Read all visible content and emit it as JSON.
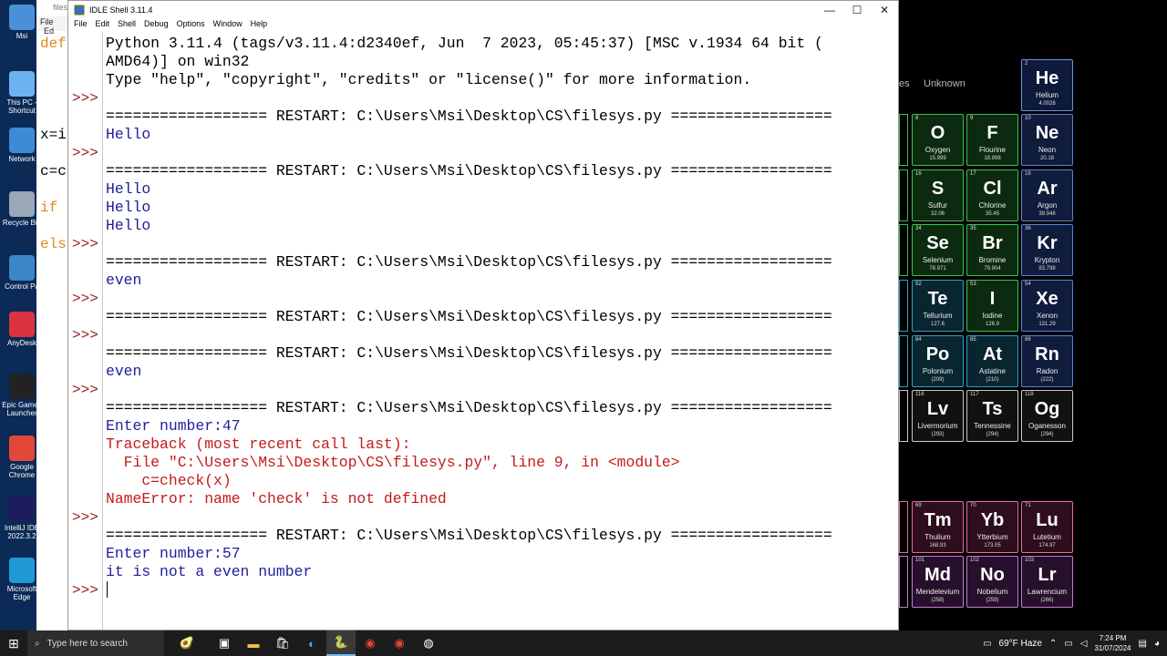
{
  "desktop": {
    "icons": [
      {
        "label": "Msi"
      },
      {
        "label": "This PC - Shortcut"
      },
      {
        "label": "Network"
      },
      {
        "label": "Recycle Bin"
      },
      {
        "label": "Control Pa"
      },
      {
        "label": "AnyDesk"
      },
      {
        "label": "Epic Games Launcher"
      },
      {
        "label": "Google Chrome"
      },
      {
        "label": "IntelliJ IDE 2022.3.2"
      },
      {
        "label": "Microsoft Edge"
      }
    ]
  },
  "back_editor": {
    "title": "files",
    "menu": [
      "File",
      "Ed"
    ],
    "code": [
      "def",
      "",
      "",
      "x=i",
      "c=c",
      "if",
      "els"
    ]
  },
  "idle": {
    "title": "IDLE Shell 3.11.4",
    "menu": [
      "File",
      "Edit",
      "Shell",
      "Debug",
      "Options",
      "Window",
      "Help"
    ],
    "controls": {
      "minimize": "—",
      "maximize": "☐",
      "close": "✕"
    },
    "prompt": ">>>",
    "lines": [
      {
        "t": "Python 3.11.4 (tags/v3.11.4:d2340ef, Jun  7 2023, 05:45:37) [MSC v.1934 64 bit (",
        "c": "out"
      },
      {
        "t": "AMD64)] on win32",
        "c": "out"
      },
      {
        "t": "Type \"help\", \"copyright\", \"credits\" or \"license()\" for more information.",
        "c": "out"
      },
      {
        "t": "",
        "c": "out"
      },
      {
        "t": "================== RESTART: C:\\Users\\Msi\\Desktop\\CS\\filesys.py ==================",
        "c": "out"
      },
      {
        "t": "Hello",
        "c": "std"
      },
      {
        "t": "",
        "c": "out"
      },
      {
        "t": "================== RESTART: C:\\Users\\Msi\\Desktop\\CS\\filesys.py ==================",
        "c": "out"
      },
      {
        "t": "Hello",
        "c": "std"
      },
      {
        "t": "Hello",
        "c": "std"
      },
      {
        "t": "Hello",
        "c": "std"
      },
      {
        "t": "",
        "c": "out"
      },
      {
        "t": "================== RESTART: C:\\Users\\Msi\\Desktop\\CS\\filesys.py ==================",
        "c": "out"
      },
      {
        "t": "even",
        "c": "std"
      },
      {
        "t": "",
        "c": "out"
      },
      {
        "t": "================== RESTART: C:\\Users\\Msi\\Desktop\\CS\\filesys.py ==================",
        "c": "out"
      },
      {
        "t": "",
        "c": "out"
      },
      {
        "t": "================== RESTART: C:\\Users\\Msi\\Desktop\\CS\\filesys.py ==================",
        "c": "out"
      },
      {
        "t": "even",
        "c": "std"
      },
      {
        "t": "",
        "c": "out"
      },
      {
        "t": "================== RESTART: C:\\Users\\Msi\\Desktop\\CS\\filesys.py ==================",
        "c": "out"
      },
      {
        "t": "Enter number:47",
        "c": "std"
      },
      {
        "t": "Traceback (most recent call last):",
        "c": "err"
      },
      {
        "t": "  File \"C:\\Users\\Msi\\Desktop\\CS\\filesys.py\", line 9, in <module>",
        "c": "err"
      },
      {
        "t": "    c=check(x)",
        "c": "err"
      },
      {
        "t": "NameError: name 'check' is not defined",
        "c": "err"
      },
      {
        "t": "",
        "c": "out"
      },
      {
        "t": "================== RESTART: C:\\Users\\Msi\\Desktop\\CS\\filesys.py ==================",
        "c": "out"
      },
      {
        "t": "Enter number:57",
        "c": "std"
      },
      {
        "t": "it is not a even number",
        "c": "std"
      }
    ],
    "prompt_rows": [
      3,
      6,
      11,
      14,
      16,
      19,
      26,
      30
    ]
  },
  "periodic": {
    "labels": {
      "left": "es",
      "unknown": "Unknown"
    },
    "elements": [
      {
        "num": "2",
        "sym": "He",
        "name": "Helium",
        "w": "4.0026",
        "g": "he",
        "col": 2,
        "row": 0
      },
      {
        "num": "8",
        "sym": "O",
        "name": "Oxygen",
        "w": "15.999",
        "g": "hal",
        "col": 0,
        "row": 1
      },
      {
        "num": "9",
        "sym": "F",
        "name": "Flourine",
        "w": "18.998",
        "g": "hal",
        "col": 1,
        "row": 1
      },
      {
        "num": "10",
        "sym": "Ne",
        "name": "Neon",
        "w": "20.18",
        "g": "nob",
        "col": 2,
        "row": 1
      },
      {
        "num": "16",
        "sym": "S",
        "name": "Sulfur",
        "w": "32.06",
        "g": "hal",
        "col": 0,
        "row": 2
      },
      {
        "num": "17",
        "sym": "Cl",
        "name": "Chlorine",
        "w": "35.45",
        "g": "hal",
        "col": 1,
        "row": 2
      },
      {
        "num": "18",
        "sym": "Ar",
        "name": "Argon",
        "w": "39.948",
        "g": "nob",
        "col": 2,
        "row": 2
      },
      {
        "num": "34",
        "sym": "Se",
        "name": "Selenium",
        "w": "78.971",
        "g": "hal",
        "col": 0,
        "row": 3
      },
      {
        "num": "35",
        "sym": "Br",
        "name": "Bromine",
        "w": "79.904",
        "g": "hal",
        "col": 1,
        "row": 3
      },
      {
        "num": "36",
        "sym": "Kr",
        "name": "Krypton",
        "w": "83.798",
        "g": "nob",
        "col": 2,
        "row": 3
      },
      {
        "num": "52",
        "sym": "Te",
        "name": "Tellurium",
        "w": "127.6",
        "g": "met",
        "col": 0,
        "row": 4
      },
      {
        "num": "53",
        "sym": "I",
        "name": "Iodine",
        "w": "126.9",
        "g": "hal",
        "col": 1,
        "row": 4
      },
      {
        "num": "54",
        "sym": "Xe",
        "name": "Xenon",
        "w": "131.29",
        "g": "nob",
        "col": 2,
        "row": 4
      },
      {
        "num": "84",
        "sym": "Po",
        "name": "Polonium",
        "w": "(209)",
        "g": "met",
        "col": 0,
        "row": 5
      },
      {
        "num": "85",
        "sym": "At",
        "name": "Astatine",
        "w": "(210)",
        "g": "met",
        "col": 1,
        "row": 5
      },
      {
        "num": "86",
        "sym": "Rn",
        "name": "Radon",
        "w": "(222)",
        "g": "nob",
        "col": 2,
        "row": 5
      },
      {
        "num": "116",
        "sym": "Lv",
        "name": "Livermorium",
        "w": "(293)",
        "g": "lv",
        "col": 0,
        "row": 6
      },
      {
        "num": "117",
        "sym": "Ts",
        "name": "Tennessine",
        "w": "(294)",
        "g": "lv",
        "col": 1,
        "row": 6
      },
      {
        "num": "118",
        "sym": "Og",
        "name": "Oganesson",
        "w": "(294)",
        "g": "lv",
        "col": 2,
        "row": 6
      },
      {
        "num": "69",
        "sym": "Tm",
        "name": "Thulium",
        "w": "168.93",
        "g": "lan",
        "col": 0,
        "row": 8
      },
      {
        "num": "70",
        "sym": "Yb",
        "name": "Ytterbium",
        "w": "173.05",
        "g": "lan",
        "col": 1,
        "row": 8
      },
      {
        "num": "71",
        "sym": "Lu",
        "name": "Lutetium",
        "w": "174.97",
        "g": "lan",
        "col": 2,
        "row": 8
      },
      {
        "num": "101",
        "sym": "Md",
        "name": "Mendelevium",
        "w": "(258)",
        "g": "act",
        "col": 0,
        "row": 9
      },
      {
        "num": "102",
        "sym": "No",
        "name": "Nobelium",
        "w": "(259)",
        "g": "act",
        "col": 1,
        "row": 9
      },
      {
        "num": "103",
        "sym": "Lr",
        "name": "Lawrencium",
        "w": "(266)",
        "g": "act",
        "col": 2,
        "row": 9
      }
    ]
  },
  "taskbar": {
    "search_placeholder": "Type here to search",
    "weather": "69°F  Haze",
    "time": "7:24 PM",
    "date": "31/07/2024"
  }
}
